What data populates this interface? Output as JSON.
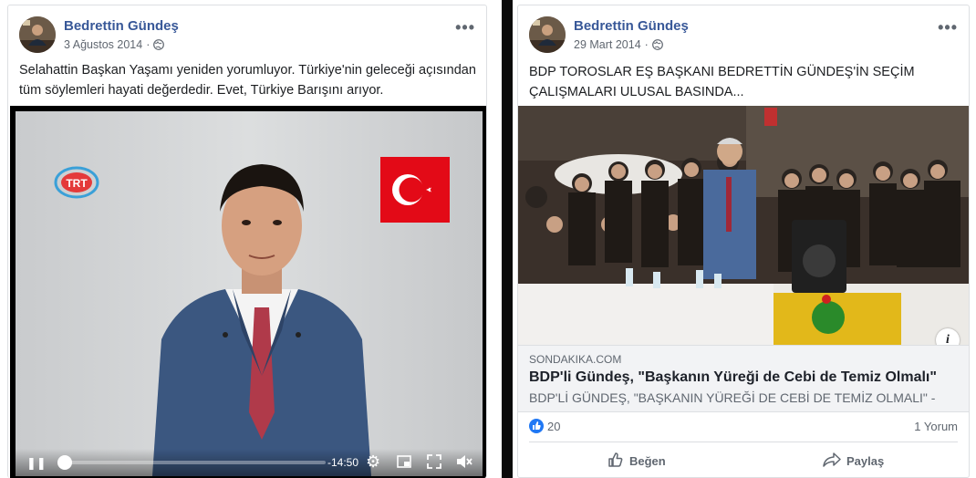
{
  "posts": [
    {
      "author": "Bedrettin Gündeş",
      "date": "3 Ağustos 2014",
      "privacy_icon": "globe-icon",
      "text_lines": [
        "Selahattin Başkan Yaşamı yeniden yorumluyor. Türkiye'nin geleceği açısından",
        "tüm söylemleri hayati değerdedir. Evet, Türkiye Barışını arıyor."
      ],
      "video": {
        "channel_logo": "TRT",
        "time_remaining": "-14:50",
        "progress": 0.0
      }
    },
    {
      "author": "Bedrettin Gündeş",
      "date": "29 Mart 2014",
      "privacy_icon": "globe-icon",
      "text_lines": [
        "BDP TOROSLAR EŞ BAŞKANI BEDRETTİN GÜNDEŞ'İN SEÇİM",
        "ÇALIŞMALARI ULUSAL BASINDA..."
      ],
      "link": {
        "domain": "SONDAKIKA.COM",
        "title": "BDP'li Gündeş, \"Başkanın Yüreği de Cebi de Temiz Olmalı\"",
        "description": "BDP'Lİ GÜNDEŞ, \"BAŞKANIN YÜREĞİ DE CEBİ DE TEMİZ OLMALI\" -"
      },
      "reaction_count": "20",
      "comment_count": "1 Yorum",
      "actions": {
        "like": "Beğen",
        "share": "Paylaş"
      }
    }
  ],
  "colors": {
    "author_link": "#385898",
    "like_blue": "#2078f4",
    "flag_red": "#e30a17"
  }
}
